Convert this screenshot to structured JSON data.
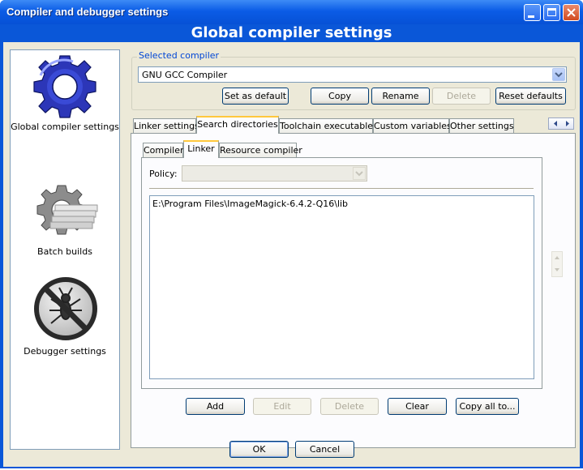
{
  "window": {
    "title": "Compiler and debugger settings"
  },
  "banner": {
    "title": "Global compiler settings"
  },
  "sidebar": {
    "items": [
      {
        "label": "Global compiler settings",
        "icon": "gear-icon"
      },
      {
        "label": "Batch builds",
        "icon": "batch-gear-icon"
      },
      {
        "label": "Debugger settings",
        "icon": "bug-icon"
      }
    ]
  },
  "compiler": {
    "group_label": "Selected compiler",
    "selected": "GNU GCC Compiler",
    "buttons": {
      "set_default": "Set as default",
      "copy": "Copy",
      "rename": "Rename",
      "delete": "Delete",
      "reset": "Reset defaults"
    }
  },
  "main_tabs": [
    "Linker settings",
    "Search directories",
    "Toolchain executables",
    "Custom variables",
    "Other settings"
  ],
  "sub_tabs": [
    "Compiler",
    "Linker",
    "Resource compiler"
  ],
  "policy": {
    "label": "Policy:",
    "value": ""
  },
  "directories": [
    "E:\\Program Files\\ImageMagick-6.4.2-Q16\\lib"
  ],
  "list_buttons": {
    "add": "Add",
    "edit": "Edit",
    "delete": "Delete",
    "clear": "Clear",
    "copy_all": "Copy all to..."
  },
  "dialog_buttons": {
    "ok": "OK",
    "cancel": "Cancel"
  }
}
